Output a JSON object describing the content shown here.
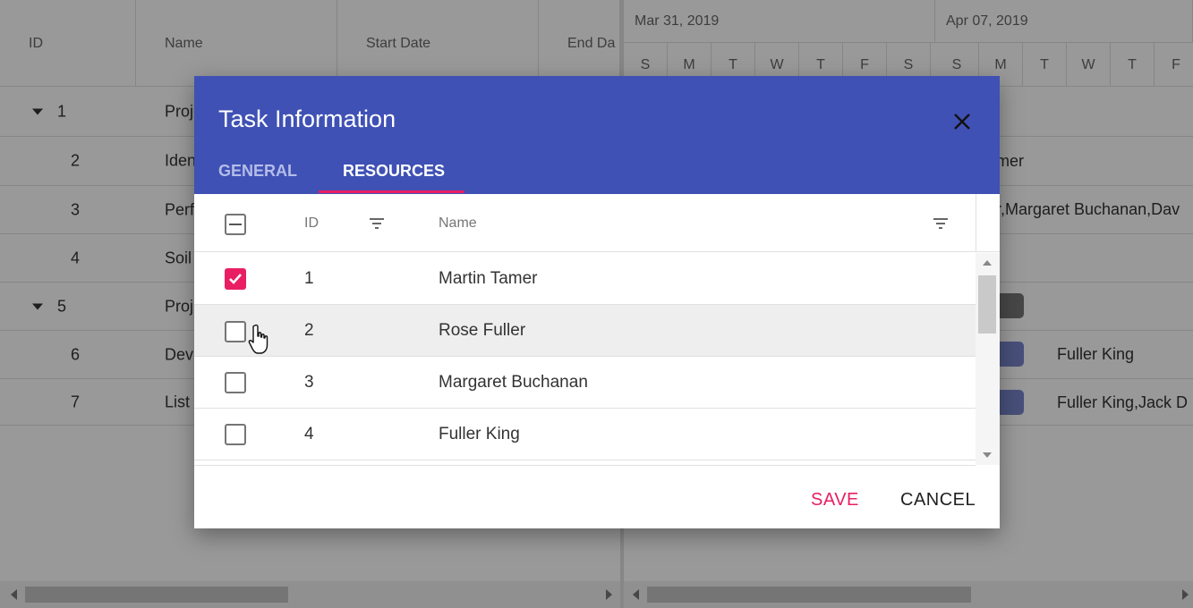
{
  "grid": {
    "headers": [
      "ID",
      "Name",
      "Start Date",
      "End Da"
    ],
    "rows": [
      {
        "id": "1",
        "name": "Proj"
      },
      {
        "id": "2",
        "name": "Iden"
      },
      {
        "id": "3",
        "name": "Perf"
      },
      {
        "id": "4",
        "name": "Soil"
      },
      {
        "id": "5",
        "name": "Proj"
      },
      {
        "id": "6",
        "name": "Dev"
      },
      {
        "id": "7",
        "name": "List"
      }
    ]
  },
  "timeline": {
    "weeks": [
      "Mar 31, 2019",
      "Apr 07, 2019"
    ],
    "days": [
      "S",
      "M",
      "T",
      "W",
      "T",
      "F",
      "S",
      "S",
      "M",
      "T",
      "W",
      "T",
      "F"
    ],
    "row_labels": {
      "r2": "mer",
      "r3": "r,Margaret Buchanan,Dav",
      "r6": "Fuller King",
      "r7": "Fuller King,Jack D"
    }
  },
  "dialog": {
    "title": "Task Information",
    "tabs": [
      {
        "label": "GENERAL",
        "active": false
      },
      {
        "label": "RESOURCES",
        "active": true
      }
    ],
    "columns": {
      "id": "ID",
      "name": "Name"
    },
    "resources": [
      {
        "id": "1",
        "name": "Martin Tamer",
        "checked": true
      },
      {
        "id": "2",
        "name": "Rose Fuller",
        "checked": false
      },
      {
        "id": "3",
        "name": "Margaret Buchanan",
        "checked": false
      },
      {
        "id": "4",
        "name": "Fuller King",
        "checked": false
      }
    ],
    "save_label": "SAVE",
    "cancel_label": "CANCEL"
  },
  "colors": {
    "header": "#3f51b5",
    "accent": "#e91e63",
    "tab_inactive": "#b5bde8"
  }
}
